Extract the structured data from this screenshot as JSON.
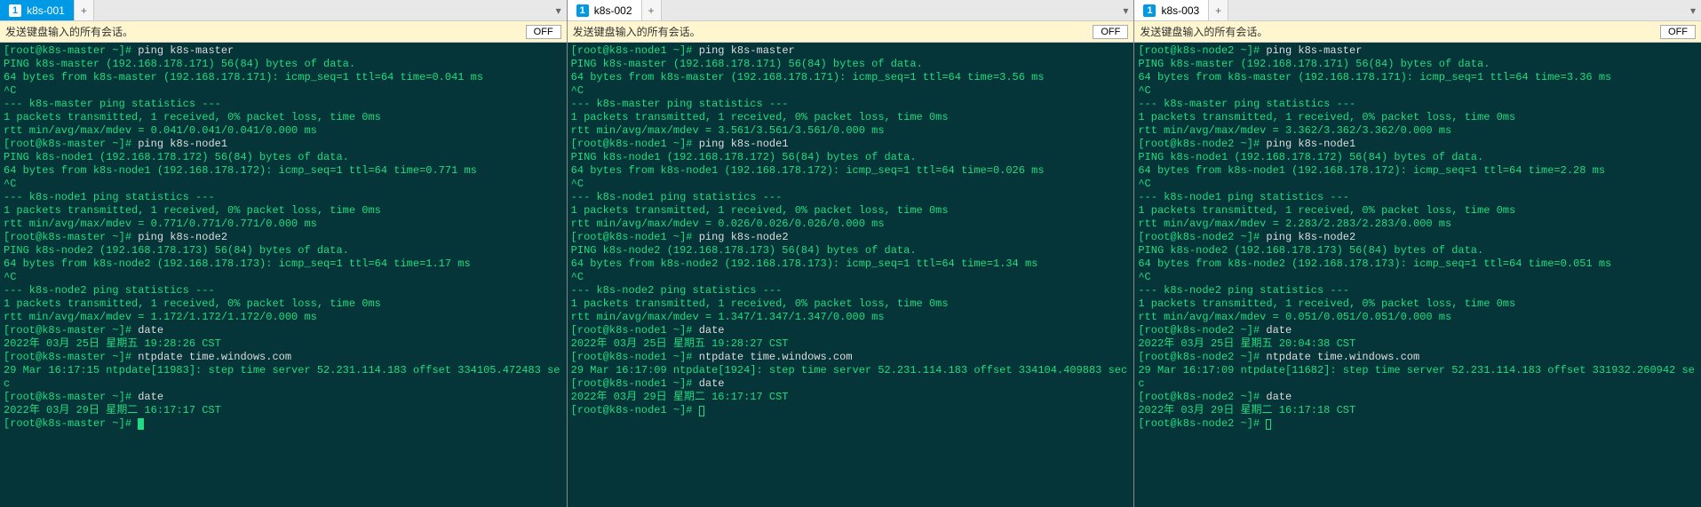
{
  "panes": [
    {
      "tab_num": "1",
      "tab_title": "k8s-001",
      "tab_active": true,
      "infobar_text": "发送键盘输入的所有会话。",
      "off_label": "OFF",
      "hostname": "k8s-master",
      "cursor_solid": true,
      "lines": [
        {
          "t": "prompt",
          "cmd": "ping k8s-master"
        },
        {
          "t": "out",
          "text": "PING k8s-master (192.168.178.171) 56(84) bytes of data."
        },
        {
          "t": "out",
          "text": "64 bytes from k8s-master (192.168.178.171): icmp_seq=1 ttl=64 time=0.041 ms"
        },
        {
          "t": "out",
          "text": "^C"
        },
        {
          "t": "out",
          "text": "--- k8s-master ping statistics ---"
        },
        {
          "t": "out",
          "text": "1 packets transmitted, 1 received, 0% packet loss, time 0ms"
        },
        {
          "t": "out",
          "text": "rtt min/avg/max/mdev = 0.041/0.041/0.041/0.000 ms"
        },
        {
          "t": "prompt",
          "cmd": "ping k8s-node1"
        },
        {
          "t": "out",
          "text": "PING k8s-node1 (192.168.178.172) 56(84) bytes of data."
        },
        {
          "t": "out",
          "text": "64 bytes from k8s-node1 (192.168.178.172): icmp_seq=1 ttl=64 time=0.771 ms"
        },
        {
          "t": "out",
          "text": "^C"
        },
        {
          "t": "out",
          "text": "--- k8s-node1 ping statistics ---"
        },
        {
          "t": "out",
          "text": "1 packets transmitted, 1 received, 0% packet loss, time 0ms"
        },
        {
          "t": "out",
          "text": "rtt min/avg/max/mdev = 0.771/0.771/0.771/0.000 ms"
        },
        {
          "t": "prompt",
          "cmd": "ping k8s-node2"
        },
        {
          "t": "out",
          "text": "PING k8s-node2 (192.168.178.173) 56(84) bytes of data."
        },
        {
          "t": "out",
          "text": "64 bytes from k8s-node2 (192.168.178.173): icmp_seq=1 ttl=64 time=1.17 ms"
        },
        {
          "t": "out",
          "text": "^C"
        },
        {
          "t": "out",
          "text": "--- k8s-node2 ping statistics ---"
        },
        {
          "t": "out",
          "text": "1 packets transmitted, 1 received, 0% packet loss, time 0ms"
        },
        {
          "t": "out",
          "text": "rtt min/avg/max/mdev = 1.172/1.172/1.172/0.000 ms"
        },
        {
          "t": "prompt",
          "cmd": "date"
        },
        {
          "t": "out",
          "text": "2022年 03月 25日 星期五 19:28:26 CST"
        },
        {
          "t": "prompt",
          "cmd": "ntpdate time.windows.com"
        },
        {
          "t": "out",
          "text": "29 Mar 16:17:15 ntpdate[11983]: step time server 52.231.114.183 offset 334105.472483 sec"
        },
        {
          "t": "prompt",
          "cmd": "date"
        },
        {
          "t": "out",
          "text": "2022年 03月 29日 星期二 16:17:17 CST"
        },
        {
          "t": "prompt",
          "cmd": "",
          "cursor": true
        }
      ]
    },
    {
      "tab_num": "1",
      "tab_title": "k8s-002",
      "tab_active": false,
      "infobar_text": "发送键盘输入的所有会话。",
      "off_label": "OFF",
      "hostname": "k8s-node1",
      "cursor_solid": false,
      "lines": [
        {
          "t": "prompt",
          "cmd": "ping k8s-master"
        },
        {
          "t": "out",
          "text": "PING k8s-master (192.168.178.171) 56(84) bytes of data."
        },
        {
          "t": "out",
          "text": "64 bytes from k8s-master (192.168.178.171): icmp_seq=1 ttl=64 time=3.56 ms"
        },
        {
          "t": "out",
          "text": "^C"
        },
        {
          "t": "out",
          "text": "--- k8s-master ping statistics ---"
        },
        {
          "t": "out",
          "text": "1 packets transmitted, 1 received, 0% packet loss, time 0ms"
        },
        {
          "t": "out",
          "text": "rtt min/avg/max/mdev = 3.561/3.561/3.561/0.000 ms"
        },
        {
          "t": "prompt",
          "cmd": "ping k8s-node1"
        },
        {
          "t": "out",
          "text": "PING k8s-node1 (192.168.178.172) 56(84) bytes of data."
        },
        {
          "t": "out",
          "text": "64 bytes from k8s-node1 (192.168.178.172): icmp_seq=1 ttl=64 time=0.026 ms"
        },
        {
          "t": "out",
          "text": "^C"
        },
        {
          "t": "out",
          "text": "--- k8s-node1 ping statistics ---"
        },
        {
          "t": "out",
          "text": "1 packets transmitted, 1 received, 0% packet loss, time 0ms"
        },
        {
          "t": "out",
          "text": "rtt min/avg/max/mdev = 0.026/0.026/0.026/0.000 ms"
        },
        {
          "t": "prompt",
          "cmd": "ping k8s-node2"
        },
        {
          "t": "out",
          "text": "PING k8s-node2 (192.168.178.173) 56(84) bytes of data."
        },
        {
          "t": "out",
          "text": "64 bytes from k8s-node2 (192.168.178.173): icmp_seq=1 ttl=64 time=1.34 ms"
        },
        {
          "t": "out",
          "text": "^C"
        },
        {
          "t": "out",
          "text": "--- k8s-node2 ping statistics ---"
        },
        {
          "t": "out",
          "text": "1 packets transmitted, 1 received, 0% packet loss, time 0ms"
        },
        {
          "t": "out",
          "text": "rtt min/avg/max/mdev = 1.347/1.347/1.347/0.000 ms"
        },
        {
          "t": "prompt",
          "cmd": "date"
        },
        {
          "t": "out",
          "text": "2022年 03月 25日 星期五 19:28:27 CST"
        },
        {
          "t": "prompt",
          "cmd": "ntpdate time.windows.com"
        },
        {
          "t": "out",
          "text": "29 Mar 16:17:09 ntpdate[1924]: step time server 52.231.114.183 offset 334104.409883 sec"
        },
        {
          "t": "prompt",
          "cmd": "date"
        },
        {
          "t": "out",
          "text": "2022年 03月 29日 星期二 16:17:17 CST"
        },
        {
          "t": "prompt",
          "cmd": "",
          "cursor": true
        }
      ]
    },
    {
      "tab_num": "1",
      "tab_title": "k8s-003",
      "tab_active": false,
      "infobar_text": "发送键盘输入的所有会话。",
      "off_label": "OFF",
      "hostname": "k8s-node2",
      "cursor_solid": false,
      "lines": [
        {
          "t": "prompt",
          "cmd": "ping k8s-master"
        },
        {
          "t": "out",
          "text": "PING k8s-master (192.168.178.171) 56(84) bytes of data."
        },
        {
          "t": "out",
          "text": "64 bytes from k8s-master (192.168.178.171): icmp_seq=1 ttl=64 time=3.36 ms"
        },
        {
          "t": "out",
          "text": "^C"
        },
        {
          "t": "out",
          "text": "--- k8s-master ping statistics ---"
        },
        {
          "t": "out",
          "text": "1 packets transmitted, 1 received, 0% packet loss, time 0ms"
        },
        {
          "t": "out",
          "text": "rtt min/avg/max/mdev = 3.362/3.362/3.362/0.000 ms"
        },
        {
          "t": "prompt",
          "cmd": "ping k8s-node1"
        },
        {
          "t": "out",
          "text": "PING k8s-node1 (192.168.178.172) 56(84) bytes of data."
        },
        {
          "t": "out",
          "text": "64 bytes from k8s-node1 (192.168.178.172): icmp_seq=1 ttl=64 time=2.28 ms"
        },
        {
          "t": "out",
          "text": "^C"
        },
        {
          "t": "out",
          "text": "--- k8s-node1 ping statistics ---"
        },
        {
          "t": "out",
          "text": "1 packets transmitted, 1 received, 0% packet loss, time 0ms"
        },
        {
          "t": "out",
          "text": "rtt min/avg/max/mdev = 2.283/2.283/2.283/0.000 ms"
        },
        {
          "t": "prompt",
          "cmd": "ping k8s-node2"
        },
        {
          "t": "out",
          "text": "PING k8s-node2 (192.168.178.173) 56(84) bytes of data."
        },
        {
          "t": "out",
          "text": "64 bytes from k8s-node2 (192.168.178.173): icmp_seq=1 ttl=64 time=0.051 ms"
        },
        {
          "t": "out",
          "text": "^C"
        },
        {
          "t": "out",
          "text": "--- k8s-node2 ping statistics ---"
        },
        {
          "t": "out",
          "text": "1 packets transmitted, 1 received, 0% packet loss, time 0ms"
        },
        {
          "t": "out",
          "text": "rtt min/avg/max/mdev = 0.051/0.051/0.051/0.000 ms"
        },
        {
          "t": "prompt",
          "cmd": "date"
        },
        {
          "t": "out",
          "text": "2022年 03月 25日 星期五 20:04:38 CST"
        },
        {
          "t": "prompt",
          "cmd": "ntpdate time.windows.com"
        },
        {
          "t": "out",
          "text": "29 Mar 16:17:09 ntpdate[11682]: step time server 52.231.114.183 offset 331932.260942 sec"
        },
        {
          "t": "prompt",
          "cmd": "date"
        },
        {
          "t": "out",
          "text": "2022年 03月 29日 星期二 16:17:18 CST"
        },
        {
          "t": "prompt",
          "cmd": "",
          "cursor": true
        }
      ]
    }
  ]
}
